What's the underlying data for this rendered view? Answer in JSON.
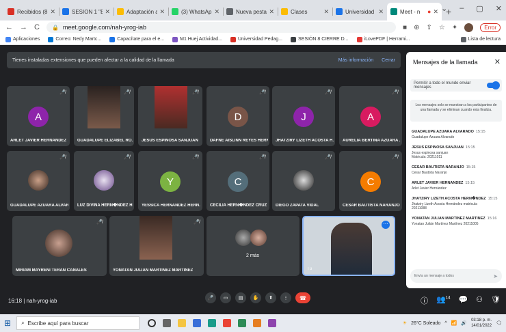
{
  "browser": {
    "tabs": [
      {
        "label": "Recibidos (8",
        "color": "#d93025",
        "active": false
      },
      {
        "label": "SESION 1 \"E",
        "color": "#1a73e8",
        "active": false
      },
      {
        "label": "Adaptación a",
        "color": "#fbbc04",
        "active": false
      },
      {
        "label": "(3) WhatsApp",
        "color": "#25d366",
        "active": false
      },
      {
        "label": "Nueva pesta",
        "color": "#5f6368",
        "active": false
      },
      {
        "label": "Clases",
        "color": "#fbbc04",
        "active": false
      },
      {
        "label": "Universidad",
        "color": "#1a73e8",
        "active": false
      },
      {
        "label": "Meet - n",
        "color": "#00897b",
        "active": true
      }
    ],
    "new_tab": "+",
    "url": "meet.google.com/nah-yrog-iab",
    "error_label": "Error",
    "bookmarks": [
      {
        "label": "Aplicaciones",
        "color": "#4285f4"
      },
      {
        "label": "Correo: Nedy Martc...",
        "color": "#0078d4"
      },
      {
        "label": "Capacítate para el e...",
        "color": "#1a73e8"
      },
      {
        "label": "M1 Huej Actividad...",
        "color": "#7e57c2"
      },
      {
        "label": "Universidad Pedag...",
        "color": "#d93025"
      },
      {
        "label": "SESIÓN 8 CIERRE D...",
        "color": "#3c4043"
      },
      {
        "label": "iLovePDF | Herrami...",
        "color": "#e53935"
      }
    ],
    "reading_list": "Lista de lectura"
  },
  "meet": {
    "banner_text": "Tienes instaladas extensiones que pueden afectar a la calidad de la llamada",
    "banner_more": "Más información",
    "banner_close": "Cerrar",
    "participants": [
      {
        "name": "ARLET JAVIER HERNANDEZ",
        "letter": "A",
        "color": "#8e24aa"
      },
      {
        "name": "GUADALUPE ELIZABEL RO...",
        "letter": "",
        "color": ""
      },
      {
        "name": "JESUS ESPINOSA SANJUAN",
        "letter": "",
        "color": ""
      },
      {
        "name": "DAFNE AISLINN REYES HERN...",
        "letter": "D",
        "color": "#795548"
      },
      {
        "name": "JHATZIRY LIZETH ACOSTA H...",
        "letter": "J",
        "color": "#8e24aa"
      },
      {
        "name": "AURELIA BERTINA AZUARA ...",
        "letter": "A",
        "color": "#d81b60"
      },
      {
        "name": "GUADALUPE AZUARA ALVAR...",
        "letter": "",
        "color": ""
      },
      {
        "name": "LUZ DIVINA HERN�NDEZ H...",
        "letter": "",
        "color": ""
      },
      {
        "name": "YESSICA HERNANDEZ HERN...",
        "letter": "Y",
        "color": "#7cb342"
      },
      {
        "name": "CECILIA HERN�NDEZ CRUZ",
        "letter": "C",
        "color": "#546e7a"
      },
      {
        "name": "DIEGO ZAPATA VIDAL",
        "letter": "",
        "color": ""
      },
      {
        "name": "CESAR BAUTISTA NARANJO",
        "letter": "C",
        "color": "#f57c00"
      },
      {
        "name": "MIRIAM MAYRENI TERAN CANALES",
        "letter": "",
        "color": ""
      },
      {
        "name": "YONATAN JULIAN MARTINEZ MARTINEZ",
        "letter": "",
        "color": ""
      },
      {
        "name": "2 más",
        "letter": "",
        "color": ""
      },
      {
        "name": "Tú",
        "letter": "",
        "color": ""
      }
    ],
    "time": "16:18",
    "meeting_code": "nah-yrog-iab",
    "participant_count": "14"
  },
  "chat": {
    "title": "Mensajes de la llamada",
    "allow_label": "Permitir a todo el mundo enviar mensajes",
    "notice": "Los mensajes solo se muestran a los participantes de una llamada y se eliminan cuando esta finaliza.",
    "messages": [
      {
        "author": "GUADALUPE AZUARA ALVARADO",
        "time": "15:15",
        "text": "Guadalupe Azuara Alvarado"
      },
      {
        "author": "JESUS ESPINOSA SANJUAN",
        "time": "15:15",
        "text": "Jesus espinosa sanjuan\nMatricula: 20211011"
      },
      {
        "author": "CESAR BAUTISTA NARANJO",
        "time": "15:15",
        "text": "Cesar Bautista Naranjo"
      },
      {
        "author": "ARLET JAVIER HERNANDEZ",
        "time": "15:15",
        "text": "Arlet Javier Hernández"
      },
      {
        "author": "JHATZIRY LIZETH ACOSTA HERN�NDEZ",
        "time": "15:15",
        "text": "Jhatziry Lizeth Acosta Hernández matricula\n20211088"
      },
      {
        "author": "YONATAN JULIAN MARTINEZ MARTINEZ",
        "time": "15:16",
        "text": "Yonatan Julián Martínez Martínez 20211005"
      }
    ],
    "input_placeholder": "Envía un mensaje a todos"
  },
  "taskbar": {
    "search_placeholder": "Escribe aquí para buscar",
    "weather": "26°C Soleado",
    "time": "03:18 p. m.",
    "date": "14/01/2022"
  }
}
